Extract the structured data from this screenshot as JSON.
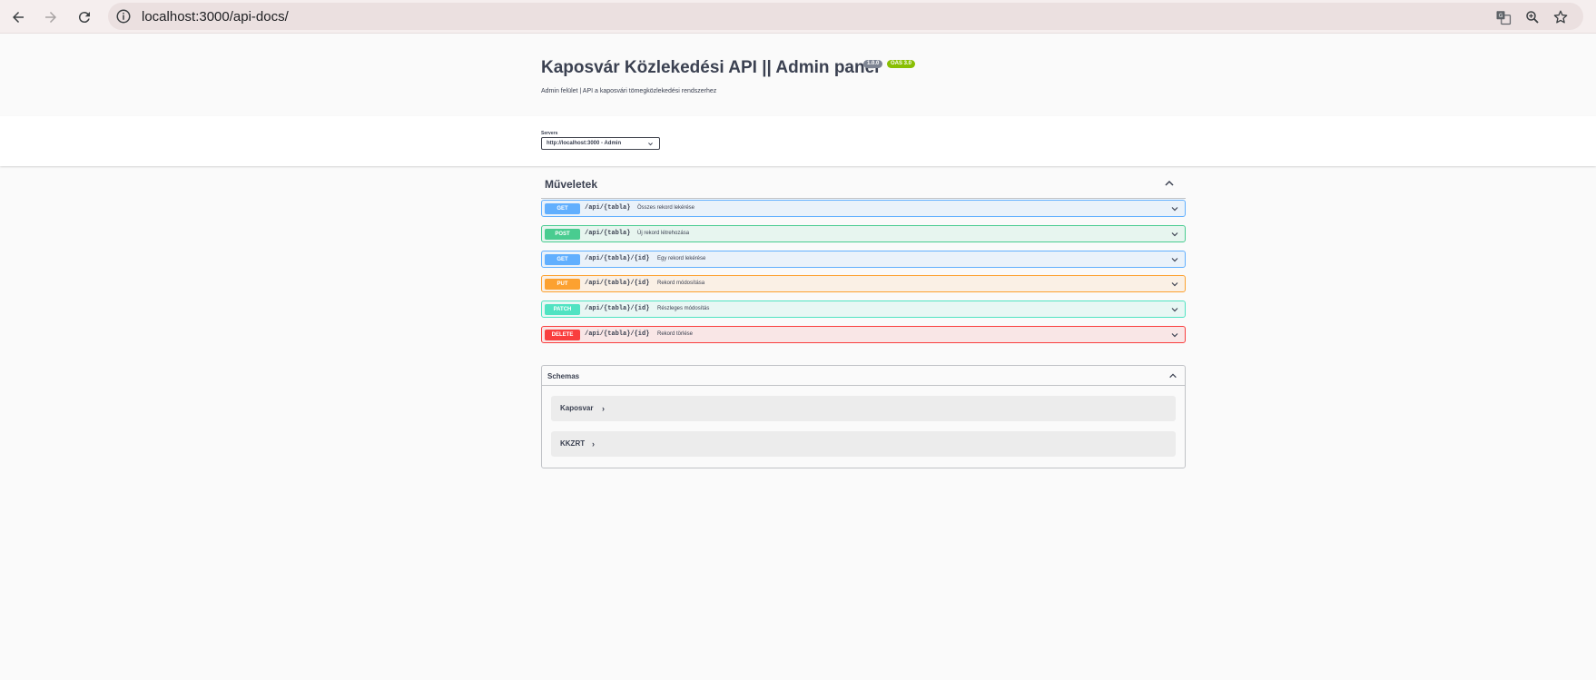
{
  "browser": {
    "url": "localhost:3000/api-docs/"
  },
  "info": {
    "title": "Kaposvár Közlekedési API || Admin panel",
    "version": "1.0.0",
    "oas": "OAS 3.0",
    "description": "Admin felület | API a kaposvári tömegközlekedési rendszerhez"
  },
  "servers": {
    "label": "Servers",
    "selected": "http://localhost:3000 - Admin"
  },
  "operations": {
    "title": "Műveletek",
    "items": [
      {
        "method": "GET",
        "path": "/api/{tabla}",
        "summary": "Összes rekord lekérése"
      },
      {
        "method": "POST",
        "path": "/api/{tabla}",
        "summary": "Új rekord létrehozása"
      },
      {
        "method": "GET",
        "path": "/api/{tabla}/{id}",
        "summary": "Egy rekord lekérése"
      },
      {
        "method": "PUT",
        "path": "/api/{tabla}/{id}",
        "summary": "Rekord módosítása"
      },
      {
        "method": "PATCH",
        "path": "/api/{tabla}/{id}",
        "summary": "Részleges módosítás"
      },
      {
        "method": "DELETE",
        "path": "/api/{tabla}/{id}",
        "summary": "Rekord törlése"
      }
    ]
  },
  "schemas": {
    "title": "Schemas",
    "models": [
      {
        "name": "Kaposvar",
        "arrow": "›"
      },
      {
        "name": "KKZRT",
        "arrow": "›"
      }
    ]
  },
  "colors": {
    "get": "#61affe",
    "post": "#49cc90",
    "put": "#fca130",
    "patch": "#50e3c2",
    "delete": "#f93e3e"
  }
}
